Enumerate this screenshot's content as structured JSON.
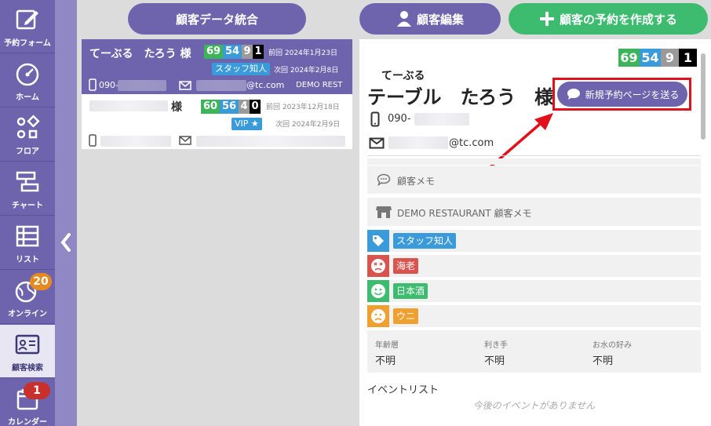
{
  "sidebar": {
    "items": [
      {
        "label": "予約フォーム",
        "icon": "edit-icon"
      },
      {
        "label": "ホーム",
        "icon": "dashboard-icon"
      },
      {
        "label": "フロア",
        "icon": "floor-icon"
      },
      {
        "label": "チャート",
        "icon": "chart-icon"
      },
      {
        "label": "リスト",
        "icon": "list-icon"
      },
      {
        "label": "オンライン",
        "icon": "globe-icon",
        "badge": "20"
      },
      {
        "label": "顧客検索",
        "icon": "customer-search-icon"
      },
      {
        "label": "カレンダー",
        "icon": "calendar-icon",
        "badge": "1"
      }
    ]
  },
  "top_buttons": {
    "merge": "顧客データ統合",
    "edit": "顧客編集",
    "create": "顧客の予約を作成する"
  },
  "list": [
    {
      "name": "てーぶる　たろう 様",
      "stats": [
        "69",
        "54",
        "9",
        "1"
      ],
      "prev": "前回 2024年1月23日",
      "next": "次回 2024年2月8日",
      "tag": "スタッフ知人",
      "phone": "090-",
      "email": "@tc.com",
      "restaurant": "DEMO REST"
    },
    {
      "name": "様",
      "stats": [
        "60",
        "56",
        "4",
        "0"
      ],
      "prev": "前回 2023年12月18日",
      "next": "次回 2024年2月9日",
      "tag": "VIP ★"
    }
  ],
  "detail": {
    "stats": [
      "69",
      "54",
      "9",
      "1"
    ],
    "furigana": "てーぶる",
    "name": "テーブル　たろう　様",
    "send_button": "新規予約ページを送る",
    "phone": "090-",
    "email": "@tc.com",
    "memo_label": "顧客メモ",
    "restaurant_memo_label": "DEMO RESTAURANT 顧客メモ",
    "tags": [
      {
        "label": "スタッフ知人",
        "color": "#3b9ad9",
        "icon": "tag-icon"
      },
      {
        "label": "海老",
        "color": "#d9534f",
        "icon": "dislike-face-icon"
      },
      {
        "label": "日本酒",
        "color": "#3dbb6f",
        "icon": "smile-face-icon"
      },
      {
        "label": "ウニ",
        "color": "#f0a030",
        "icon": "sad-face-icon"
      }
    ],
    "info": [
      {
        "label": "年齢層",
        "value": "不明"
      },
      {
        "label": "利き手",
        "value": "不明"
      },
      {
        "label": "お水の好み",
        "value": "不明"
      }
    ],
    "event_title": "イベントリスト",
    "event_empty": "今後のイベントがありません"
  },
  "colors": {
    "primary": "#6e64ae",
    "green": "#3dbb6f",
    "stat_green": "#3db35a",
    "stat_blue": "#3b9ad9",
    "stat_gray": "#9a9a9a",
    "stat_black": "#000000",
    "highlight": "#e0111b"
  }
}
